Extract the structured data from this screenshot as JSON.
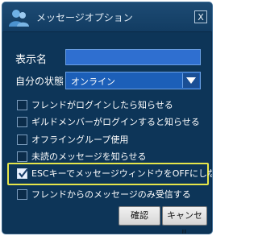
{
  "dialog": {
    "title": "メッセージオプション",
    "close_label": "X"
  },
  "form": {
    "name_label": "表示名",
    "name_value": "",
    "status_label": "自分の状態",
    "status_value": "オンライン"
  },
  "options": [
    {
      "label": "フレンドがログインしたら知らせる",
      "checked": false
    },
    {
      "label": "ギルドメンバーがログインすると知らせる",
      "checked": false
    },
    {
      "label": "オフライングループ使用",
      "checked": false
    },
    {
      "label": "未読のメッセージを知らせる",
      "checked": false
    },
    {
      "label": "ESCキーでメッセージウィンドウをOFFにしない",
      "checked": true
    },
    {
      "label": "フレンドからのメッセージのみ受信する",
      "checked": false
    }
  ],
  "buttons": {
    "confirm_label": "確認",
    "cancel_label": "キャンセル"
  },
  "colors": {
    "dialog_bg": "#0d3558",
    "highlight": "#e6e64a"
  }
}
